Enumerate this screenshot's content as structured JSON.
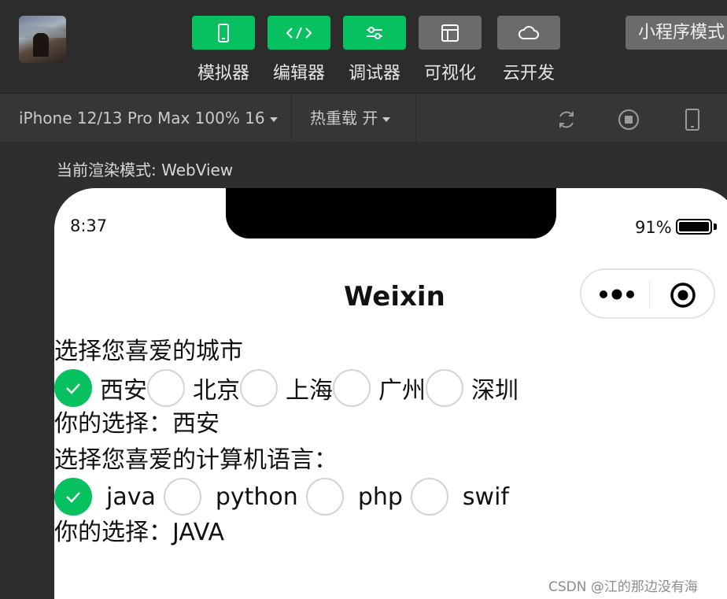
{
  "toolbar": {
    "tools": [
      {
        "label": "模拟器",
        "icon": "phone-icon"
      },
      {
        "label": "编辑器",
        "icon": "code-icon"
      },
      {
        "label": "调试器",
        "icon": "sliders-icon"
      },
      {
        "label": "可视化",
        "icon": "layout-icon"
      },
      {
        "label": "云开发",
        "icon": "cloud-icon"
      }
    ],
    "mode_label": "小程序模式",
    "accent_color": "#07c160"
  },
  "devbar": {
    "device": "iPhone 12/13 Pro Max 100% 16",
    "hot_reload": "热重载 开"
  },
  "canvas": {
    "render_mode": "当前渲染模式: WebView"
  },
  "phone": {
    "time": "8:37",
    "battery": "91%",
    "nav_title": "Weixin"
  },
  "page": {
    "city_prompt": "选择您喜爱的城市",
    "cities": [
      "西安",
      "北京",
      "上海",
      "广州",
      "深圳"
    ],
    "city_selected_index": 0,
    "city_result": "你的选择：西安",
    "lang_prompt": "选择您喜爱的计算机语言：",
    "languages": [
      "java",
      "python",
      "php",
      "swif"
    ],
    "lang_selected_index": 0,
    "lang_result": "你的选择：JAVA"
  },
  "watermark": "CSDN @江的那边没有海"
}
